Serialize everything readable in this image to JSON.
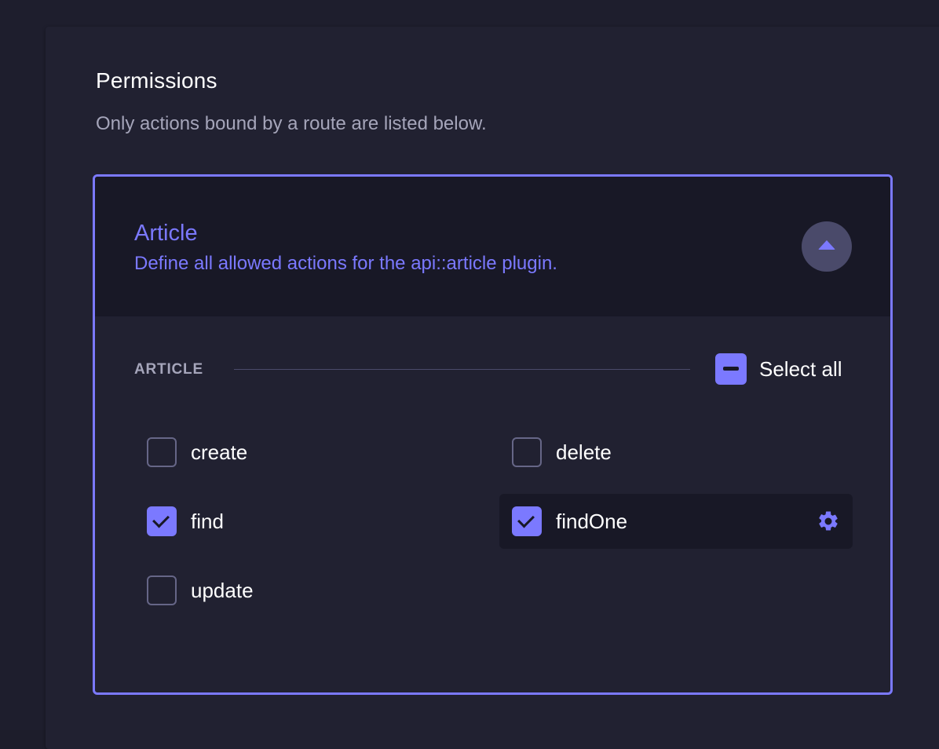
{
  "permissions": {
    "title": "Permissions",
    "subtitle": "Only actions bound by a route are listed below."
  },
  "accordion": {
    "title": "Article",
    "description": "Define all allowed actions for the api::article plugin.",
    "expanded": true,
    "toggle_icon": "chevron-up-icon"
  },
  "section": {
    "label": "ARTICLE",
    "select_all_label": "Select all",
    "select_all_state": "indeterminate"
  },
  "actions": [
    {
      "label": "create",
      "checked": false
    },
    {
      "label": "delete",
      "checked": false
    },
    {
      "label": "find",
      "checked": true
    },
    {
      "label": "findOne",
      "checked": true,
      "active": true,
      "icon": "gear-icon"
    },
    {
      "label": "update",
      "checked": false
    }
  ],
  "colors": {
    "accent": "#7b79ff",
    "background": "#212131",
    "header_background": "#181826",
    "text": "#ffffff",
    "muted_text": "#a5a5ba"
  }
}
